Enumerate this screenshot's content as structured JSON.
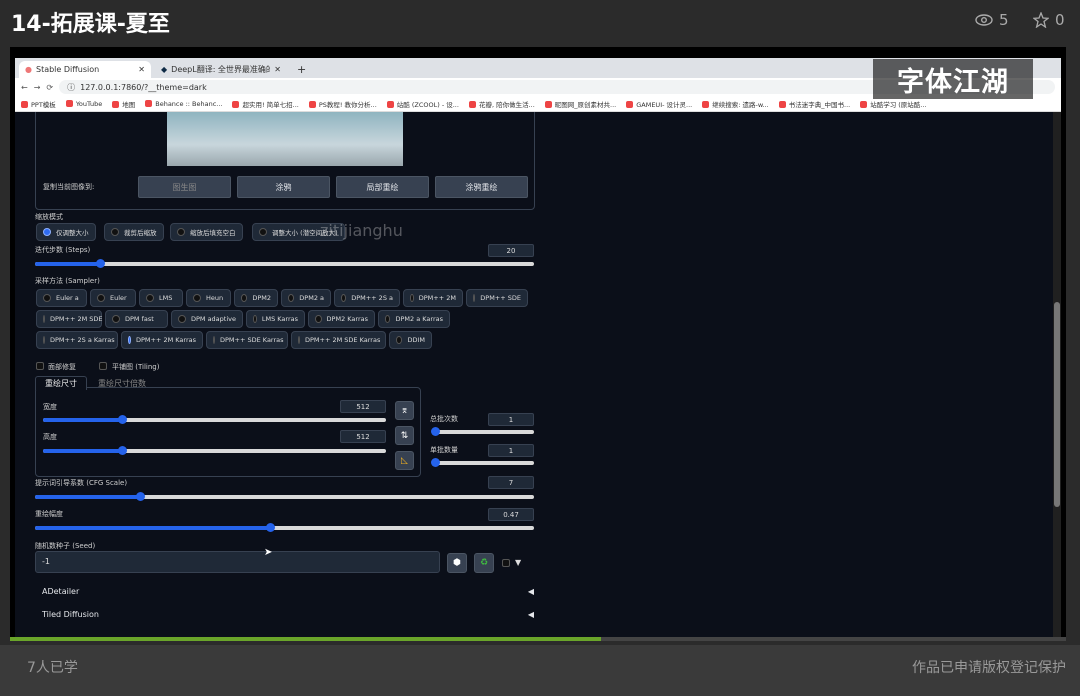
{
  "header": {
    "title": "14-拓展课-夏至",
    "views": "5",
    "favorites": "0"
  },
  "footer": {
    "learners": "7人已学",
    "copyright": "作品已申请版权登记保护"
  },
  "video": {
    "progress": 0.56
  },
  "browser": {
    "tab1": "Stable Diffusion",
    "tab2": "DeepL翻译: 全世界最准确的翻...",
    "url": "127.0.0.1:7860/?__theme=dark",
    "bookmarks": [
      "PPT模板",
      "YouTube",
      "地图",
      "Behance :: Behanc...",
      "超实用! 简单七招...",
      "PS教程! 教你分析...",
      "站酷 (ZCOOL) - 设...",
      "花瓣, 陪你做生活...",
      "昵图网_原创素材共...",
      "GAMEUI- 设计灵...",
      "继续搜索: 遗路-w...",
      "书法迷字典_中国书...",
      "站酷学习 (原站酷..."
    ]
  },
  "logo": "字体江湖",
  "watermark": "zitijianghu",
  "sd": {
    "copy_label": "复制当前图像到:",
    "copy_buttons": [
      "图生图",
      "涂鸦",
      "局部重绘",
      "涂鸦重绘"
    ],
    "resize_label": "缩放模式",
    "resize_options": [
      "仅调整大小",
      "裁剪后缩放",
      "缩放后填充空白",
      "调整大小 (潜空间放大)"
    ],
    "steps_label": "迭代步数 (Steps)",
    "steps_value": "20",
    "steps_frac": 0.13,
    "sampler_label": "采样方法 (Sampler)",
    "samplers_row1": [
      "Euler a",
      "Euler",
      "LMS",
      "Heun",
      "DPM2",
      "DPM2 a",
      "DPM++ 2S a",
      "DPM++ 2M",
      "DPM++ SDE"
    ],
    "samplers_row2": [
      "DPM++ 2M SDE",
      "DPM fast",
      "DPM adaptive",
      "LMS Karras",
      "DPM2 Karras",
      "DPM2 a Karras"
    ],
    "samplers_row3": [
      "DPM++ 2S a Karras",
      "DPM++ 2M Karras",
      "DPM++ SDE Karras",
      "DPM++ 2M SDE Karras",
      "DDIM"
    ],
    "selected_sampler": "DPM++ 2M Karras",
    "face_restore": "面部修复",
    "tiling": "平铺图 (Tiling)",
    "tab_resize": "重绘尺寸",
    "tab_scale": "重绘尺寸倍数",
    "width_label": "宽度",
    "width_value": "512",
    "width_frac": 0.23,
    "height_label": "高度",
    "height_value": "512",
    "height_frac": 0.23,
    "batch_count_label": "总批次数",
    "batch_count_value": "1",
    "batch_size_label": "单批数量",
    "batch_size_value": "1",
    "cfg_label": "提示词引导系数 (CFG Scale)",
    "cfg_value": "7",
    "cfg_frac": 0.21,
    "denoise_label": "重绘幅度",
    "denoise_value": "0.47",
    "denoise_frac": 0.47,
    "seed_label": "随机数种子 (Seed)",
    "seed_value": "-1",
    "accordion1": "ADetailer",
    "accordion2": "Tiled Diffusion"
  },
  "colors": {
    "accent": "#2563eb",
    "progress": "#6aa52a"
  }
}
